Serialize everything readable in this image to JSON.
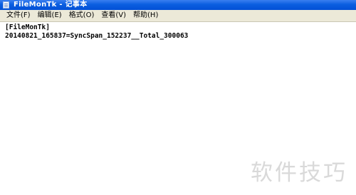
{
  "window": {
    "title": "FileMonTk - 记事本",
    "icon": "notepad-icon"
  },
  "menu": {
    "items": [
      "文件(F)",
      "编辑(E)",
      "格式(O)",
      "查看(V)",
      "帮助(H)"
    ]
  },
  "editor": {
    "lines": [
      "[FileMonTk]",
      "20140821_165837=SyncSpan_152237__Total_300063"
    ]
  },
  "watermark": {
    "text": "软件技巧"
  }
}
